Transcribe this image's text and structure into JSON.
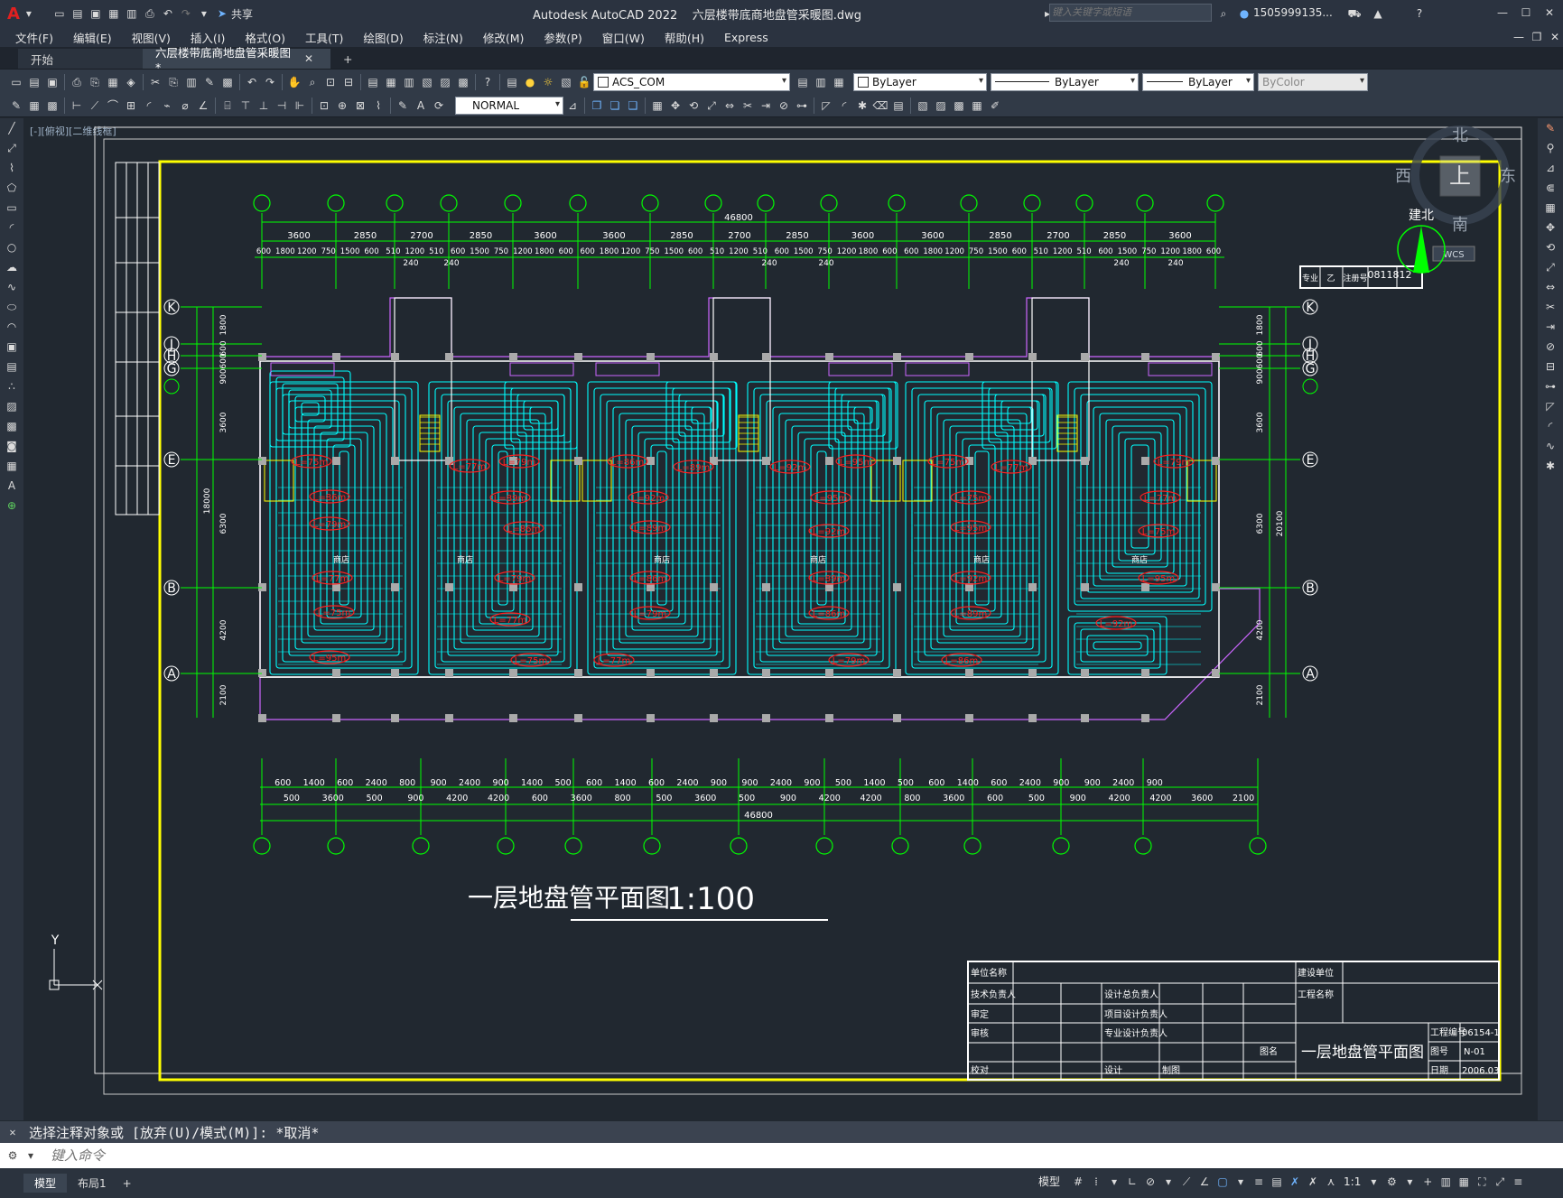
{
  "app": {
    "logo": "A",
    "title": "Autodesk AutoCAD 2022    六层楼带底商地盘管采暖图.dwg",
    "search_placeholder": "键入关键字或短语",
    "user": "1505999135...",
    "share": "共享"
  },
  "menu": [
    "文件(F)",
    "编辑(E)",
    "视图(V)",
    "插入(I)",
    "格式(O)",
    "工具(T)",
    "绘图(D)",
    "标注(N)",
    "修改(M)",
    "参数(P)",
    "窗口(W)",
    "帮助(H)",
    "Express"
  ],
  "tabs": {
    "start": "开始",
    "active": "六层楼带底商地盘管采暖图*",
    "add": "+"
  },
  "toolbar": {
    "layer": "ACS_COM",
    "color": "ByLayer",
    "linetype": "ByLayer",
    "lineweight": "ByLayer",
    "plotstyle": "ByColor",
    "dimstyle": "NORMAL"
  },
  "viewport_label": "[-][俯视][二维线框]",
  "compass": {
    "n": "北",
    "s": "南",
    "e": "东",
    "w": "西",
    "top": "上",
    "label": "建北",
    "wcs": "WCS"
  },
  "drawing": {
    "top_total": "46800",
    "top_dims_1": [
      "3600",
      "2850",
      "2700",
      "2850",
      "3600",
      "3600",
      "2850",
      "2700",
      "2850",
      "3600",
      "3600",
      "2850",
      "2700",
      "2850",
      "3600"
    ],
    "top_dims_2": [
      "600",
      "1800",
      "1200",
      "750",
      "1500",
      "600",
      "510",
      "1200",
      "510",
      "600",
      "1500",
      "750",
      "1200",
      "1800",
      "600",
      "600",
      "1800",
      "1200",
      "750",
      "1500",
      "600",
      "510",
      "1200",
      "510",
      "600",
      "1500",
      "750",
      "1200",
      "1800",
      "600",
      "600",
      "1800",
      "1200",
      "750",
      "1500",
      "600",
      "510",
      "1200",
      "510",
      "600",
      "1500",
      "750",
      "1200",
      "1800",
      "600"
    ],
    "dim_240": "240",
    "bottom_total": "46800",
    "bottom_dims_1": [
      "600",
      "1400",
      "600",
      "2400",
      "800",
      "900",
      "2400",
      "900",
      "1400",
      "500",
      "600",
      "1400",
      "600",
      "2400",
      "900",
      "900",
      "2400",
      "900",
      "500",
      "1400",
      "500",
      "600",
      "1400",
      "600",
      "2400",
      "900",
      "900",
      "2400",
      "900"
    ],
    "bottom_dims_2": [
      "500",
      "3600",
      "500",
      "900",
      "4200",
      "4200",
      "600",
      "3600",
      "800",
      "500",
      "3600",
      "500",
      "900",
      "4200",
      "4200",
      "800",
      "3600",
      "600",
      "500",
      "900",
      "4200",
      "4200",
      "3600",
      "2100"
    ],
    "left_dims": [
      "1800",
      "600",
      "600",
      "900",
      "3600",
      "6300",
      "4200",
      "2100"
    ],
    "left_total": "18000",
    "right_total": "20100",
    "axes_rows": [
      "K",
      "J",
      "H",
      "G",
      "E",
      "B",
      "A"
    ],
    "room_label": "商店",
    "loop_labels": [
      "L=75m",
      "L=77m",
      "L=79m",
      "L=86m",
      "L=89m",
      "L=92m",
      "L=95m"
    ],
    "drawing_title": "一层地盘管平面图",
    "scale": "1:100",
    "stamp_code": "0811812",
    "stamp_cells": [
      "专业",
      "乙",
      "注册号"
    ]
  },
  "titleblock": {
    "r1": [
      "单位名称",
      "",
      "建设单位",
      ""
    ],
    "r2": [
      "技术负责人",
      "",
      "设计总负责人",
      "",
      "工程名称",
      ""
    ],
    "r3": [
      "审定",
      "",
      "项目设计负责人",
      "",
      "工程编号",
      "06154-1"
    ],
    "r4": [
      "审核",
      "",
      "专业设计负责人",
      "",
      "图名",
      "一层地盘管平面图",
      "图号",
      "N-01"
    ],
    "r5": [
      "校对",
      "",
      "设计",
      "制图",
      "日期",
      "2006.03"
    ]
  },
  "command": {
    "history": "选择注释对象或 [放弃(U)/模式(M)]: *取消*",
    "placeholder": "键入命令"
  },
  "status": {
    "model_tab": "模型",
    "layout_tab": "布局1",
    "add": "+",
    "model": "模型",
    "scale": "1:1"
  },
  "axis_y": "Y",
  "colors": {
    "bg": "#212830",
    "pipe": "#00ffff",
    "grid": "#00ff00",
    "frame": "#ffff00",
    "label": "#ff2020",
    "wall": "#cc66ff"
  }
}
